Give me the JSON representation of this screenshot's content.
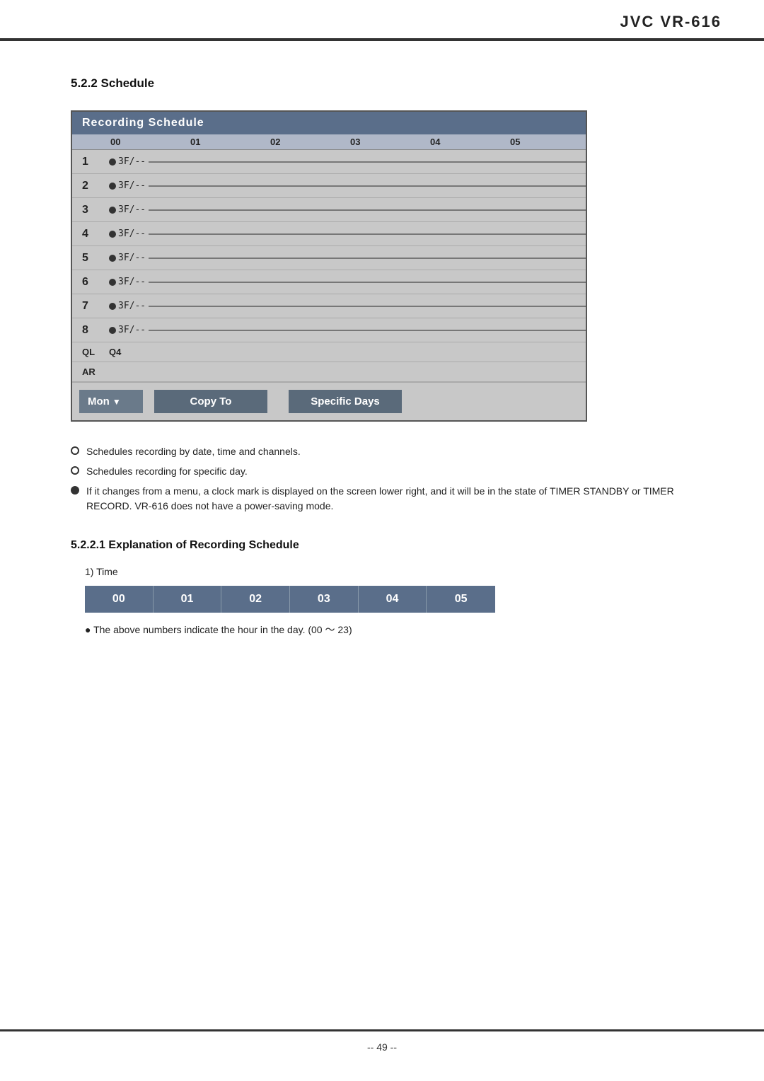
{
  "brand": "JVC VR-616",
  "section": {
    "title": "5.2.2 Schedule",
    "schedule_table": {
      "header": "Recording  Schedule",
      "time_headers": [
        "00",
        "01",
        "02",
        "03",
        "04",
        "05"
      ],
      "rows": [
        {
          "label": "1",
          "text": "3F/--"
        },
        {
          "label": "2",
          "text": "3F/--"
        },
        {
          "label": "3",
          "text": "3F/--"
        },
        {
          "label": "4",
          "text": "3F/--"
        },
        {
          "label": "5",
          "text": "3F/--"
        },
        {
          "label": "6",
          "text": "3F/--"
        },
        {
          "label": "7",
          "text": "3F/--"
        },
        {
          "label": "8",
          "text": "3F/--"
        }
      ],
      "ql_label": "QL",
      "ql_value": "Q4",
      "ar_label": "AR",
      "ar_value": "",
      "mon_label": "Mon",
      "copy_to_label": "Copy To",
      "specific_days_label": "Specific Days"
    },
    "bullets": [
      {
        "type": "open",
        "text": "Schedules recording by date, time and channels."
      },
      {
        "type": "open",
        "text": "Schedules recording for specific day."
      },
      {
        "type": "filled",
        "text": "If it changes from a menu, a clock mark is displayed on the screen lower right, and it will be in the state of TIMER STANDBY or TIMER RECORD. VR-616 does not have a power-saving mode."
      }
    ],
    "subsection": {
      "title": "5.2.2.1 Explanation of Recording Schedule",
      "time_section_label": "1) Time",
      "time_cells": [
        "00",
        "01",
        "02",
        "03",
        "04",
        "05"
      ],
      "time_note": "● The above numbers indicate the hour in the day. (00 ～ 23)"
    }
  },
  "footer": {
    "page": "-- 49 --"
  }
}
